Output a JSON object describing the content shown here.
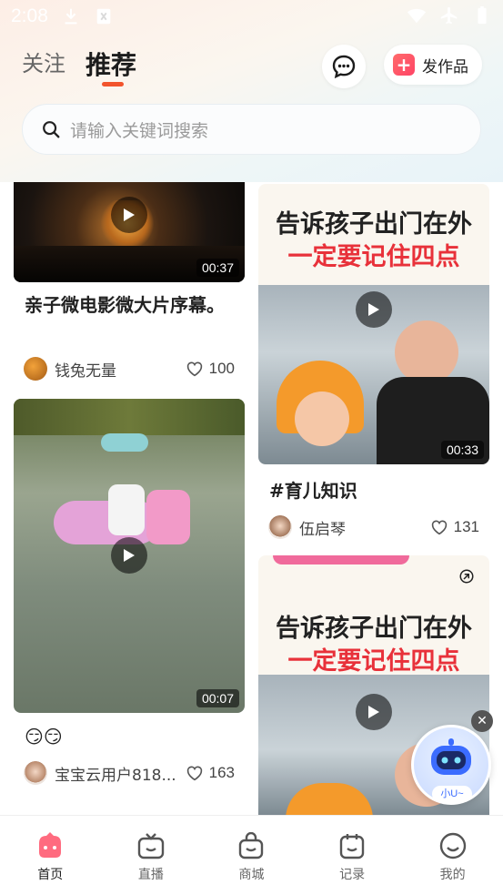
{
  "status_bar": {
    "time": "2:08"
  },
  "header": {
    "tabs": [
      {
        "label": "关注",
        "active": false
      },
      {
        "label": "推荐",
        "active": true
      }
    ],
    "post_button_label": "发作品",
    "accent_color": "#f2542d"
  },
  "search": {
    "placeholder": "请输入关键词搜索"
  },
  "feed": {
    "left": [
      {
        "title": "亲子微电影微大片序幕。",
        "author": "钱兔无量",
        "likes": "100",
        "duration": "00:37"
      },
      {
        "title": "😏😏",
        "author": "宝宝云用户818...",
        "likes": "163",
        "duration": "00:07"
      }
    ],
    "right": [
      {
        "poster_line1": "告诉孩子出门在外",
        "poster_line2": "一定要记住四点",
        "title": "#育儿知识",
        "author": "伍启琴",
        "likes": "131",
        "duration": "00:33"
      },
      {
        "poster_line1": "告诉孩子出门在外",
        "poster_line2": "一定要记住四点"
      }
    ]
  },
  "assistant": {
    "label": "小U~"
  },
  "bottom_nav": [
    {
      "label": "首页",
      "active": true
    },
    {
      "label": "直播",
      "active": false
    },
    {
      "label": "商城",
      "active": false
    },
    {
      "label": "记录",
      "active": false
    },
    {
      "label": "我的",
      "active": false
    }
  ]
}
